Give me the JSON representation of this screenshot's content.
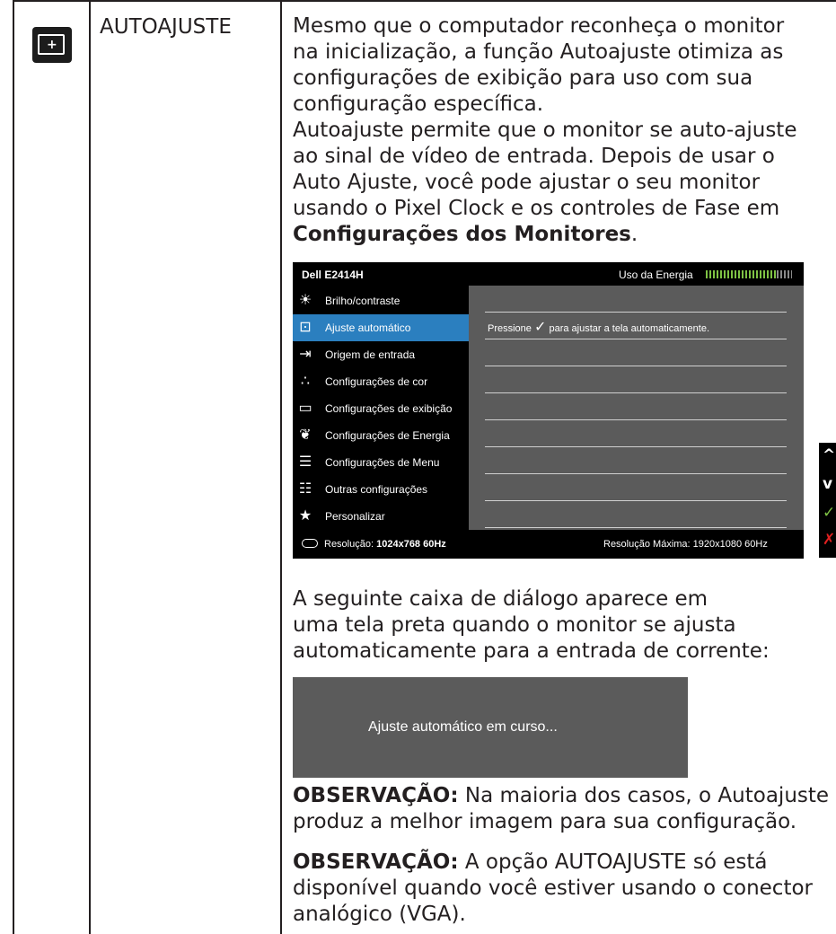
{
  "feature": {
    "name": "AUTOAJUSTE",
    "icon": "auto-adjust-icon"
  },
  "description": {
    "lines": [
      "Mesmo que o computador reconheça o monitor",
      "na inicialização, a função Autoajuste otimiza as",
      "configurações de exibição para uso com sua",
      "configuração específica.",
      "Autoajuste permite que o monitor se auto-ajuste",
      "ao sinal de vídeo de entrada. Depois de usar o",
      "Auto Ajuste, você pode ajustar o seu monitor",
      "usando o Pixel Clock e os controles de Fase em"
    ],
    "link_text": "Configurações dos Monitores",
    "link_suffix": "."
  },
  "osd": {
    "model": "Dell E2414H",
    "energy_label": "Uso da Energia",
    "energy_level": 0.82,
    "menu": [
      {
        "label": "Brilho/contraste",
        "icon": "brightness-icon",
        "active": false
      },
      {
        "label": "Ajuste automático",
        "icon": "auto-adjust-icon",
        "active": true
      },
      {
        "label": "Origem de entrada",
        "icon": "input-source-icon",
        "active": false
      },
      {
        "label": "Configurações de cor",
        "icon": "color-icon",
        "active": false
      },
      {
        "label": "Configurações de exibição",
        "icon": "display-icon",
        "active": false
      },
      {
        "label": "Configurações de Energia",
        "icon": "energy-icon",
        "active": false
      },
      {
        "label": "Configurações de Menu",
        "icon": "menu-icon",
        "active": false
      },
      {
        "label": "Outras configurações",
        "icon": "sliders-icon",
        "active": false
      },
      {
        "label": "Personalizar",
        "icon": "star-icon",
        "active": false
      }
    ],
    "panel_text_before": "Pressione",
    "panel_check": "✓",
    "panel_text_after": "para ajustar a tela automaticamente.",
    "resolution_label": "Resolução:",
    "resolution_value": "1024x768 60Hz",
    "max_resolution": "Resolução Máxima: 1920x1080 60Hz",
    "side_buttons": [
      {
        "glyph": "^",
        "icon": "up-icon",
        "color": "#ffffff"
      },
      {
        "glyph": "v",
        "icon": "down-icon",
        "color": "#ffffff"
      },
      {
        "glyph": "✓",
        "icon": "check-icon",
        "color": "#7ec244"
      },
      {
        "glyph": "✗",
        "icon": "close-icon",
        "color": "#e02020"
      }
    ]
  },
  "dialog_intro": [
    "A seguinte caixa de diálogo aparece em",
    "uma tela preta quando o monitor se ajusta",
    "automaticamente para a entrada de corrente:"
  ],
  "progress_dialog": {
    "text": "Ajuste automático em curso..."
  },
  "notes": [
    {
      "label": "OBSERVAÇÃO:",
      "lines": [
        " Na maioria dos casos, o Autoajuste",
        "produz a melhor imagem para sua configuração."
      ]
    },
    {
      "label": "OBSERVAÇÃO:",
      "lines": [
        " A opção AUTOAJUSTE só está",
        "disponível quando você estiver usando o conector",
        "analógico (VGA)."
      ]
    }
  ]
}
